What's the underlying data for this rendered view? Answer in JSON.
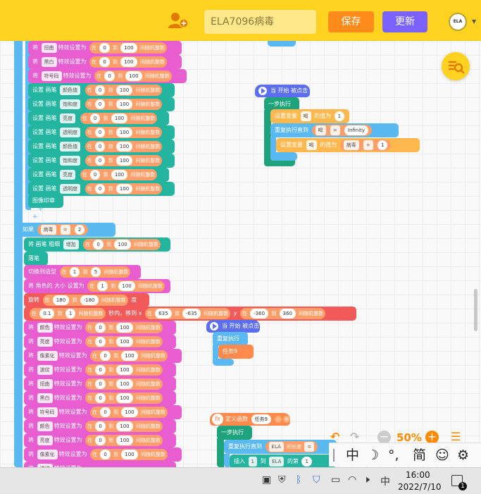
{
  "topbar": {
    "project_title": "ELA7096病毒",
    "save_label": "保存",
    "update_label": "更新",
    "logo_text": "ELA"
  },
  "blocks": {
    "set_effect": "特效设置为",
    "set_pen": "设置 画笔",
    "to": "到",
    "at": "在",
    "random": "间随机整数",
    "stamp": "图像印章",
    "if": "如果",
    "pen_up": "落笔",
    "pen_size_prefix": "将 画笔 粗细",
    "increase": "增加",
    "switch_costume": "切换到造型",
    "size_prefix": "将 角色的 大小 设置为",
    "rotate": "旋转",
    "degrees": "度",
    "glide_secs": "秒内，移到 x",
    "y": "y",
    "when_clicked": "当 开始 被点击",
    "step_exec": "一步执行",
    "repeat": "重复执行",
    "repeat_until": "重复执行直到",
    "set_var": "设置变量",
    "value_of": "的值为",
    "define_func": "定义函数",
    "task9": "任务9",
    "insert": "插入",
    "length": "的长度",
    "position": "的第",
    "plus": "+",
    "eq": "="
  },
  "dropdowns": {
    "distort": "扭曲",
    "bw": "黑白",
    "symbol": "符号码",
    "color_value": "颜色值",
    "saturation": "饱和度",
    "brightness": "亮度",
    "transparency": "透明度",
    "color": "颜色",
    "pixelate": "像素化",
    "wave": "波纹",
    "virus_var": "病毒",
    "he_var": "喝",
    "increase": "增加",
    "ela": "ELA",
    "one": "1"
  },
  "numbers": {
    "zero": "0",
    "hundred": "100",
    "one": "1",
    "two": "2",
    "five": "5",
    "n180": "180",
    "nm180": "-180",
    "p01": "0.1",
    "n635": "635",
    "nm635": "-635",
    "nm360": "-360",
    "n360": "360",
    "infinity": "Infinity"
  },
  "zoom": {
    "level": "50%"
  },
  "ime": {
    "mode": "中",
    "moon": "☽",
    "punct": "°,",
    "simplified": "简",
    "emoji": "☺",
    "settings": "⚙"
  },
  "taskbar": {
    "lang": "中",
    "time": "16:00",
    "date": "2022/7/10",
    "notifications": "1"
  }
}
